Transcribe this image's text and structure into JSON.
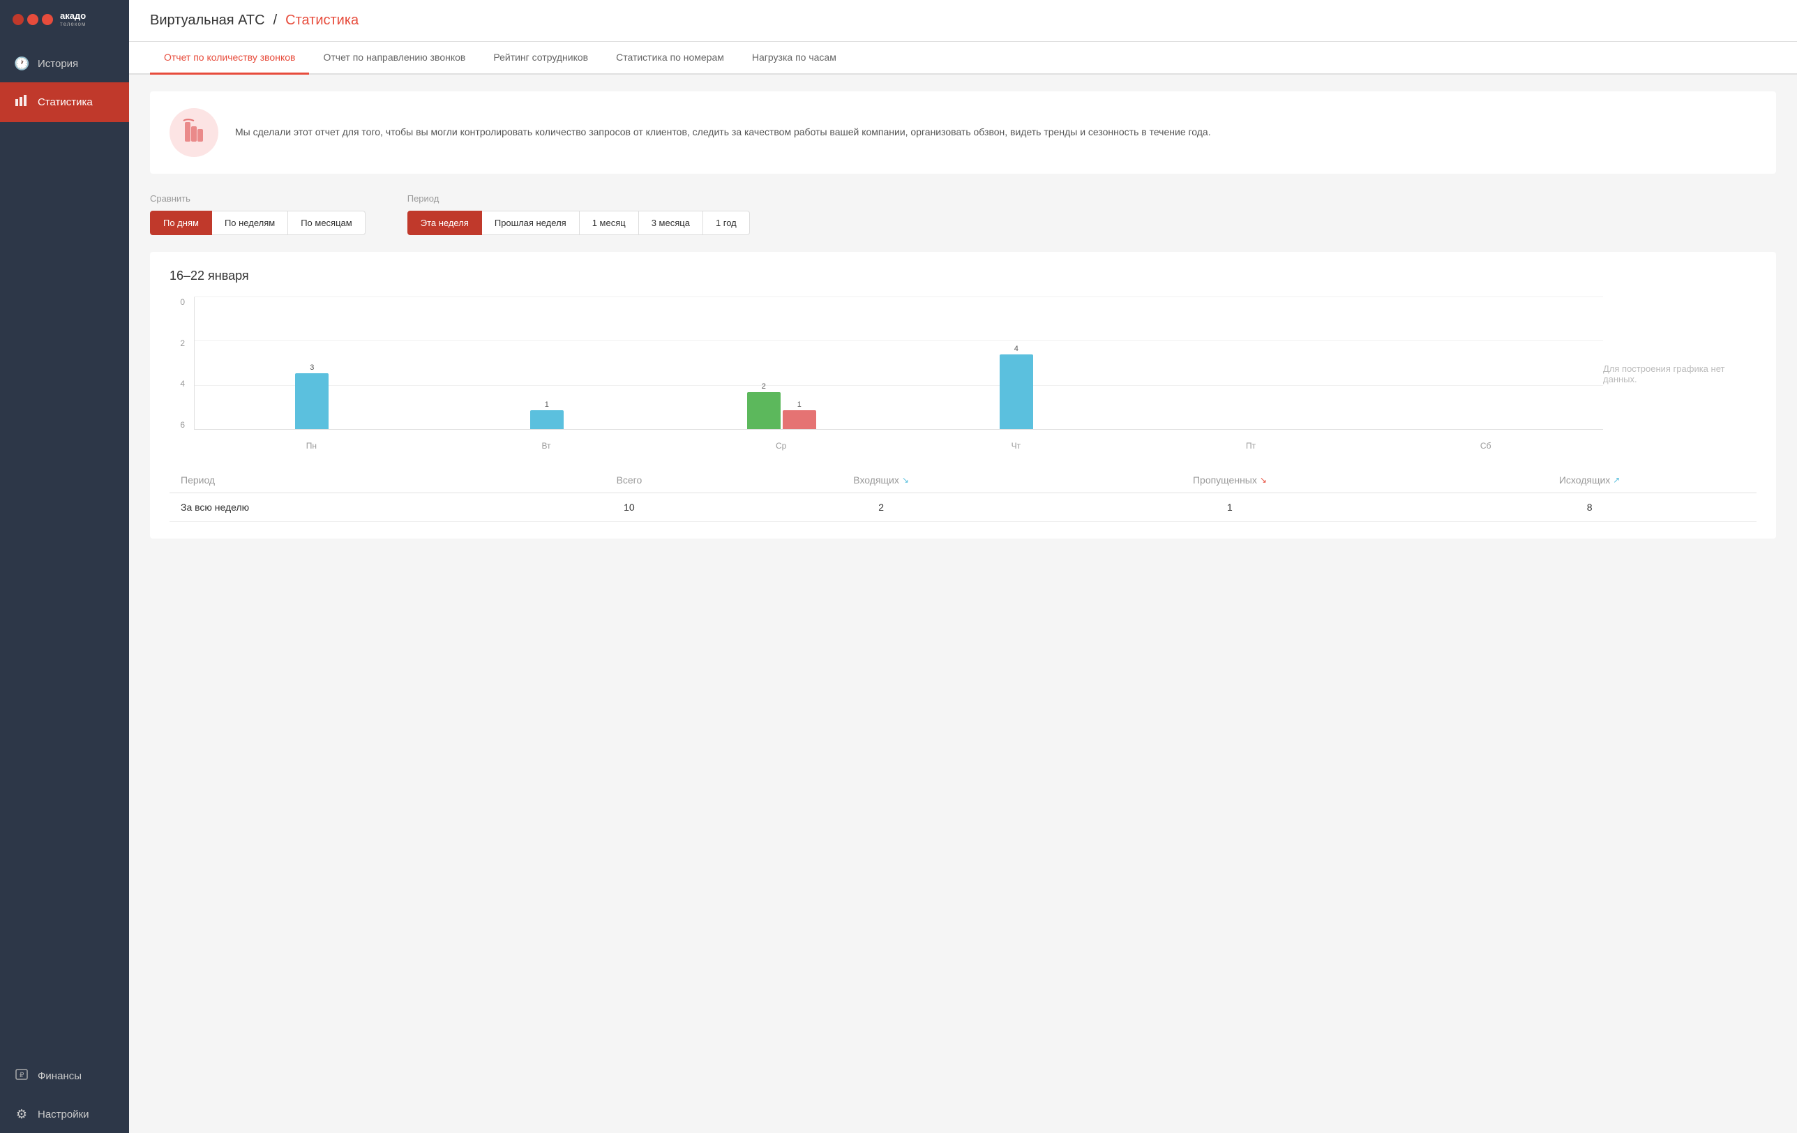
{
  "sidebar": {
    "logo": {
      "text": "акадо",
      "subtext": "телеком"
    },
    "items": [
      {
        "id": "history",
        "label": "История",
        "icon": "🕐",
        "active": false
      },
      {
        "id": "statistics",
        "label": "Статистика",
        "icon": "📊",
        "active": true
      },
      {
        "id": "finance",
        "label": "Финансы",
        "icon": "₽",
        "active": false
      },
      {
        "id": "settings",
        "label": "Настройки",
        "icon": "⚙",
        "active": false
      }
    ]
  },
  "header": {
    "breadcrumb_plain": "Виртуальная АТС",
    "separator": "/",
    "breadcrumb_active": "Статистика"
  },
  "tabs": [
    {
      "id": "call-count",
      "label": "Отчет по количеству звонков",
      "active": true
    },
    {
      "id": "call-direction",
      "label": "Отчет по направлению звонков",
      "active": false
    },
    {
      "id": "employee-rating",
      "label": "Рейтинг сотрудников",
      "active": false
    },
    {
      "id": "number-stats",
      "label": "Статистика по номерам",
      "active": false
    },
    {
      "id": "hourly-load",
      "label": "Нагрузка по часам",
      "active": false
    }
  ],
  "info_banner": {
    "text": "Мы сделали этот отчет для того, чтобы вы могли контролировать количество запросов от клиентов, следить за качеством работы вашей компании, организовать обзвон, видеть тренды и сезонность в течение года."
  },
  "controls": {
    "compare_label": "Сравнить",
    "compare_options": [
      {
        "id": "by-days",
        "label": "По дням",
        "active": true
      },
      {
        "id": "by-weeks",
        "label": "По неделям",
        "active": false
      },
      {
        "id": "by-months",
        "label": "По месяцам",
        "active": false
      }
    ],
    "period_label": "Период",
    "period_options": [
      {
        "id": "this-week",
        "label": "Эта неделя",
        "active": true
      },
      {
        "id": "last-week",
        "label": "Прошлая неделя",
        "active": false
      },
      {
        "id": "1-month",
        "label": "1 месяц",
        "active": false
      },
      {
        "id": "3-months",
        "label": "3 месяца",
        "active": false
      },
      {
        "id": "1-year",
        "label": "1 год",
        "active": false
      }
    ]
  },
  "chart": {
    "period_title": "16–22 января",
    "y_labels": [
      "0",
      "2",
      "4",
      "6"
    ],
    "x_labels": [
      "Пн",
      "Вт",
      "Ср",
      "Чт",
      "Пт",
      "Сб"
    ],
    "bars": [
      {
        "day": "Пн",
        "blue": 3,
        "green": 0,
        "pink": 0
      },
      {
        "day": "Вт",
        "blue": 1,
        "green": 0,
        "pink": 0
      },
      {
        "day": "Ср",
        "blue": 0,
        "green": 2,
        "pink": 1
      },
      {
        "day": "Чт",
        "blue": 4,
        "green": 0,
        "pink": 0
      },
      {
        "day": "Пт",
        "blue": 0,
        "green": 0,
        "pink": 0
      },
      {
        "day": "Сб",
        "blue": 0,
        "green": 0,
        "pink": 0
      }
    ],
    "max_value": 6,
    "no_data_text": "Для построения графика нет данных."
  },
  "table": {
    "columns": [
      {
        "id": "period",
        "label": "Период"
      },
      {
        "id": "total",
        "label": "Всего"
      },
      {
        "id": "incoming",
        "label": "Входящих"
      },
      {
        "id": "missed",
        "label": "Пропущенных"
      },
      {
        "id": "outgoing",
        "label": "Исходящих"
      }
    ],
    "rows": [
      {
        "period": "За всю неделю",
        "total": "10",
        "incoming": "2",
        "missed": "1",
        "outgoing": "8"
      }
    ]
  }
}
